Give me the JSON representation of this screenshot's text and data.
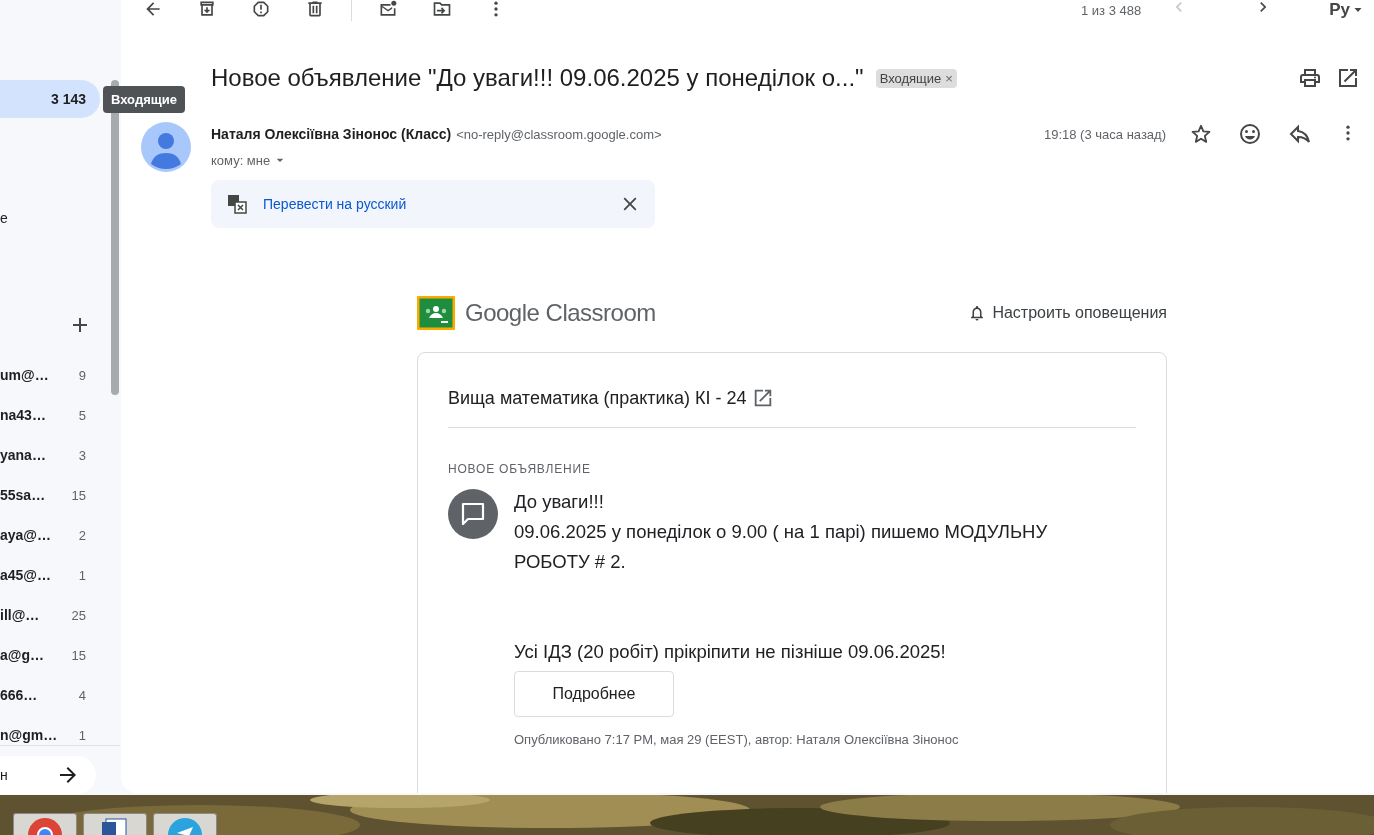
{
  "sidebar": {
    "folders": [
      {
        "count": "3 143",
        "selected": true
      },
      {
        "label": "е",
        "selected": false
      }
    ],
    "tooltip": "Входящие",
    "labels": [
      {
        "label": "um@…",
        "count": "9"
      },
      {
        "label": "na43…",
        "count": "5"
      },
      {
        "label": "yana…",
        "count": "3"
      },
      {
        "label": "55sa…",
        "count": "15"
      },
      {
        "label": "aya@…",
        "count": "2"
      },
      {
        "label": "a45@…",
        "count": "1"
      },
      {
        "label": "ill@…",
        "count": "25"
      },
      {
        "label": "a@g…",
        "count": "15"
      },
      {
        "label": "666…",
        "count": "4"
      },
      {
        "label": "n@gm…",
        "count": "1"
      }
    ],
    "bottom_field": "н"
  },
  "toolbar": {
    "pagination": "1 из 3 488",
    "input_tool": "Ру"
  },
  "message": {
    "subject": "Новое объявление \"До уваги!!! 09.06.2025 у понеділок о...\"",
    "chip": {
      "label": "Входящие",
      "remove": "×"
    },
    "sender_name": "Наталя Олексіївна Зінонос (Класс)",
    "sender_email": "<no-reply@classroom.google.com>",
    "to": "кому: мне",
    "time": "19:18 (3 часа назад)",
    "starred": false,
    "translate": "Перевести на русский"
  },
  "body": {
    "brand": "Google Classroom",
    "notify": "Настроить оповещения",
    "course": "Вища математика (практика) КІ - 24",
    "heading": "НОВОЕ ОБЪЯВЛЕНИЕ",
    "text": "До уваги!!!\n09.06.2025 у понеділок о 9.00 ( на 1 парі) пишемо МОДУЛЬНУ РОБОТУ # 2.\n\n\nУсі ІДЗ (20 робіт) прікріпити не пізніше 09.06.2025!",
    "button": "Подробнее",
    "footer": "Опубликовано 7:17 PM, мая 29 (EEST), автор: Наталя Олексіївна Зінонос"
  }
}
